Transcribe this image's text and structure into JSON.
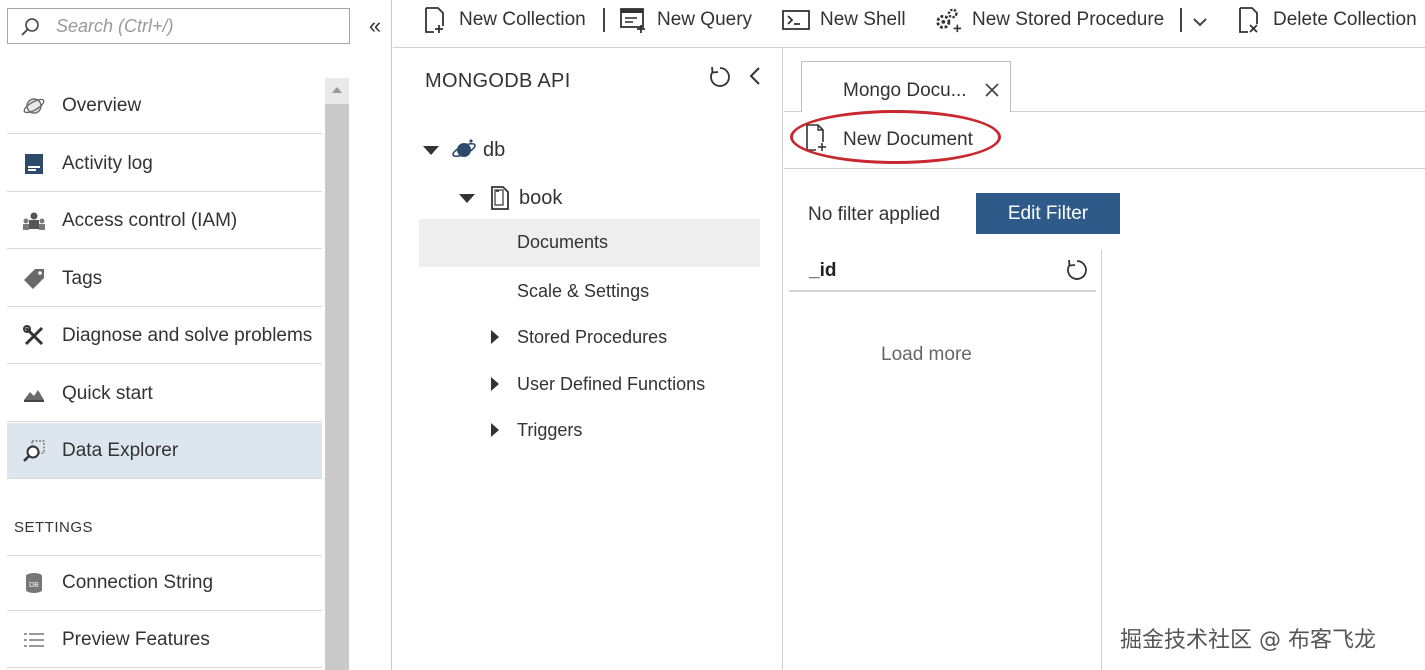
{
  "search": {
    "placeholder": "Search (Ctrl+/)"
  },
  "nav": {
    "items": [
      {
        "label": "Overview",
        "icon": "overview-icon"
      },
      {
        "label": "Activity log",
        "icon": "activity-log-icon"
      },
      {
        "label": "Access control (IAM)",
        "icon": "iam-icon"
      },
      {
        "label": "Tags",
        "icon": "tag-icon"
      },
      {
        "label": "Diagnose and solve problems",
        "icon": "wrench-icon"
      },
      {
        "label": "Quick start",
        "icon": "quick-start-icon"
      },
      {
        "label": "Data Explorer",
        "icon": "data-explorer-icon"
      }
    ],
    "settings_heading": "SETTINGS",
    "settings_items": [
      {
        "label": "Connection String",
        "icon": "database-icon"
      },
      {
        "label": "Preview Features",
        "icon": "list-icon"
      }
    ]
  },
  "commands": {
    "new_collection": "New Collection",
    "new_query": "New Query",
    "new_shell": "New Shell",
    "new_stored_procedure": "New Stored Procedure",
    "delete_collection": "Delete Collection"
  },
  "tree": {
    "title": "MONGODB API",
    "database": "db",
    "collection": "book",
    "children": [
      "Documents",
      "Scale & Settings"
    ],
    "expandable": [
      "Stored Procedures",
      "User Defined Functions",
      "Triggers"
    ]
  },
  "tab": {
    "label": "Mongo Docu..."
  },
  "toolbar": {
    "new_document": "New Document"
  },
  "filter": {
    "status": "No filter applied",
    "edit_label": "Edit Filter"
  },
  "results": {
    "column": "_id",
    "load_more": "Load more"
  },
  "watermark": "掘金技术社区 @ 布客飞龙",
  "colors": {
    "accent": "#2e5a8a",
    "selected_nav": "#dde6ef",
    "highlight": "#c8282d"
  }
}
